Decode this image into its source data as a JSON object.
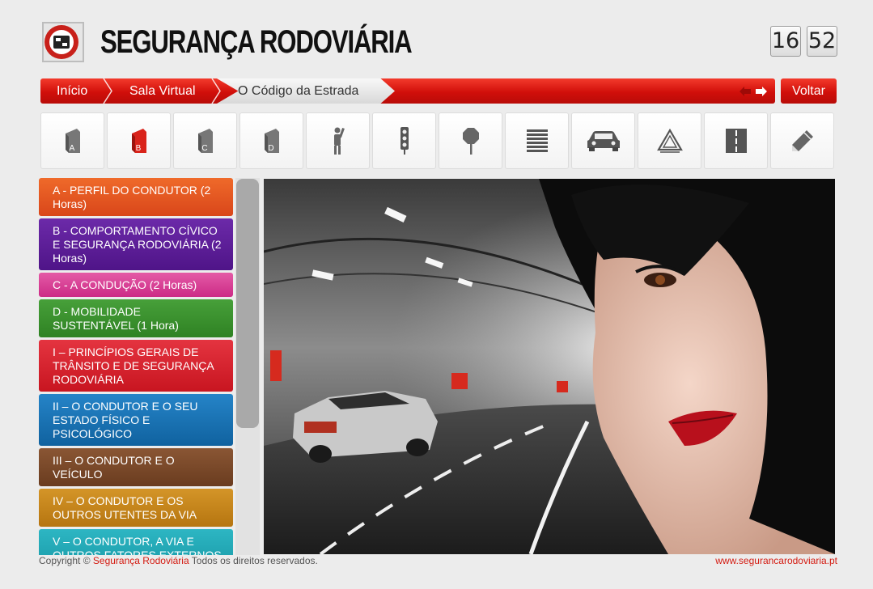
{
  "header": {
    "brand": "SEGURANÇA RODOVIÁRIA",
    "clock_hours": "16",
    "clock_minutes": "52"
  },
  "breadcrumb": {
    "items": [
      "Início",
      "Sala Virtual",
      "O Código da Estrada"
    ],
    "back_label": "Voltar"
  },
  "toolbar": {
    "items": [
      {
        "icon": "book-a-icon",
        "letter": "A"
      },
      {
        "icon": "book-b-icon",
        "letter": "B",
        "active": true
      },
      {
        "icon": "book-c-icon",
        "letter": "C"
      },
      {
        "icon": "book-d-icon",
        "letter": "D"
      },
      {
        "icon": "traffic-agent-icon"
      },
      {
        "icon": "traffic-light-icon"
      },
      {
        "icon": "road-sign-icon"
      },
      {
        "icon": "road-markings-icon"
      },
      {
        "icon": "car-icon"
      },
      {
        "icon": "warning-triangle-icon"
      },
      {
        "icon": "road-icon"
      },
      {
        "icon": "pencil-icon"
      }
    ]
  },
  "sidebar": {
    "items": [
      {
        "label": "A - PERFIL DO CONDUTOR (2 Horas)",
        "color": "#e4521a"
      },
      {
        "label": "B - COMPORTAMENTO CÍVICO E SEGURANÇA RODOVIÁRIA (2 Horas)",
        "color": "#5c1c97"
      },
      {
        "label": "C - A CONDUÇÃO (2 Horas)",
        "color": "#d73c93"
      },
      {
        "label": "D - MOBILIDADE SUSTENTÁVEL (1 Hora)",
        "color": "#3a8f2c"
      },
      {
        "label": "I – PRINCÍPIOS GERAIS DE TRÂNSITO E DE SEGURANÇA RODOVIÁRIA",
        "color": "#d9212b"
      },
      {
        "label": "II – O CONDUTOR E O SEU ESTADO FÍSICO E PSICOLÓGICO",
        "color": "#1a73b8"
      },
      {
        "label": "III – O CONDUTOR E O VEÍCULO",
        "color": "#7a4a2a"
      },
      {
        "label": "IV – O CONDUTOR E OS OUTROS UTENTES DA VIA",
        "color": "#c7861a"
      },
      {
        "label": "V – O CONDUTOR, A VIA E OUTROS FATORES EXTERNOS",
        "color": "#1ea7b5"
      }
    ]
  },
  "footer": {
    "copyright_prefix": "Copyright ©",
    "copyright_brand": "Segurança Rodoviária",
    "copyright_suffix": "Todos os direitos reservados.",
    "website": "www.segurancarodoviaria.pt"
  },
  "colors": {
    "accent_red": "#d10f0a",
    "page_bg": "#ececec"
  }
}
